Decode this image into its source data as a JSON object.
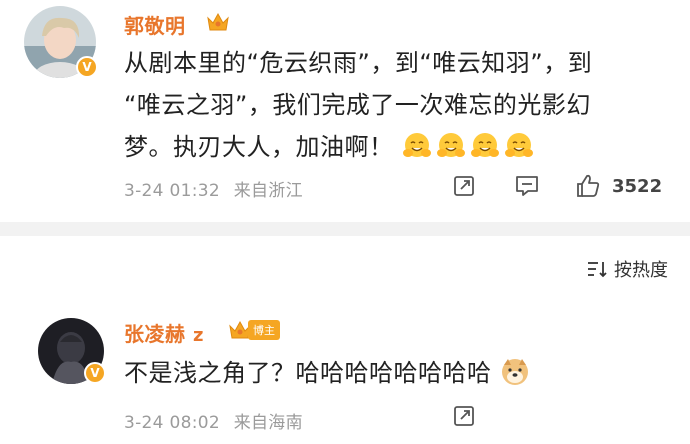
{
  "post": {
    "username": "郭敬明",
    "content_line1": "从剧本里的“危云织雨”，到“唯云知羽”，到",
    "content_line2": "“唯云之羽”，我们完成了一次难忘的光影幻",
    "content_line3": "梦。执刃大人，加油啊！",
    "date": "3-24 01:32",
    "location": "来自浙江",
    "likes": "3522",
    "emoji_count": 4
  },
  "sort": {
    "label": "按热度"
  },
  "reply": {
    "username": "张凌赫",
    "username_suffix": "z",
    "badge": "博主",
    "content": "不是浅之角了？哈哈哈哈哈哈哈哈",
    "date": "3-24 08:02",
    "location": "来自海南"
  },
  "colors": {
    "username": "#e8762c",
    "meta": "#9b9b9b",
    "badge": "#f5a623",
    "divider": "#f2f2f2"
  }
}
